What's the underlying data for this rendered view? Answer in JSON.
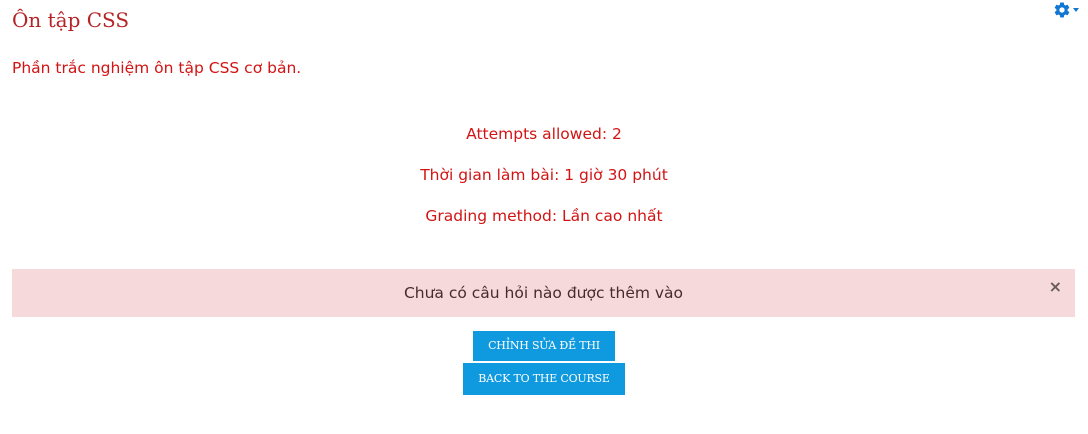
{
  "page": {
    "title": "Ôn tập CSS",
    "intro": "Phần trắc nghiệm ôn tập CSS cơ bản."
  },
  "header": {
    "settings_icon": "gear-icon",
    "dropdown_icon": "caret-down-icon",
    "accent_color": "#1177d1"
  },
  "quiz_info": {
    "attempts": "Attempts allowed: 2",
    "time_limit": "Thời gian làm bài: 1 giờ 30 phút",
    "grading_method": "Grading method: Lần cao nhất",
    "text_color": "#d21414"
  },
  "alert": {
    "message": "Chưa có câu hỏi nào được thêm vào",
    "close_label": "×",
    "background": "#f6dadb"
  },
  "actions": {
    "edit_quiz_label": "CHỈNH SỬA ĐỀ THI",
    "back_label": "BACK TO THE COURSE",
    "button_color": "#0f9ae0"
  }
}
